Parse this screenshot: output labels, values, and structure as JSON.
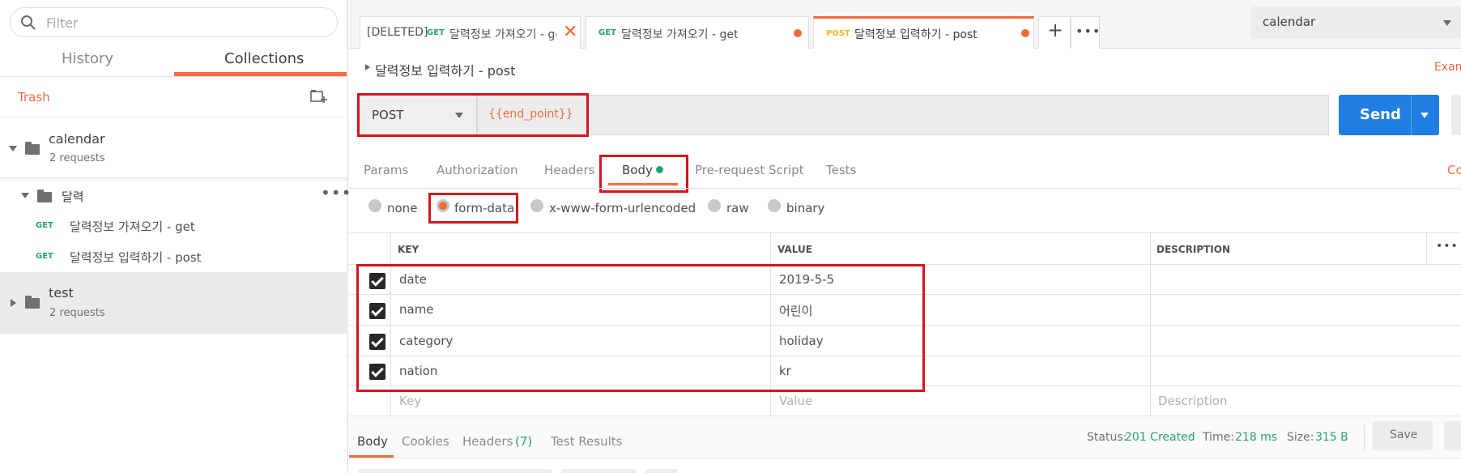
{
  "sidebar": {
    "filter_placeholder": "Filter",
    "tabs": [
      "History",
      "Collections"
    ],
    "trash_label": "Trash",
    "collections": [
      {
        "name": "calendar",
        "count": "2 requests"
      },
      {
        "name": "test",
        "count": "2 requests"
      }
    ],
    "folder": {
      "name": "달력"
    },
    "requests": [
      {
        "method": "GET",
        "name": "달력정보 가져오기 - get"
      },
      {
        "method": "GET",
        "name": "달력정보 입력하기 - post"
      }
    ]
  },
  "tabs": [
    {
      "prefix": "[DELETED]",
      "method": "GET",
      "name": "달력정보 가져오기 - get"
    },
    {
      "method": "GET",
      "name": "달력정보 가져오기 - get"
    },
    {
      "method": "POST",
      "name": "달력정보 입력하기 - post"
    }
  ],
  "environment": "calendar",
  "request": {
    "title": "달력정보 입력하기 - post",
    "examples_label": "Exam",
    "method": "POST",
    "url": "{{end_point}}",
    "send_label": "Send"
  },
  "request_tabs": [
    "Params",
    "Authorization",
    "Headers",
    "Body",
    "Pre-request Script",
    "Tests"
  ],
  "right_link": "Co",
  "body_types": [
    "none",
    "form-data",
    "x-www-form-urlencoded",
    "raw",
    "binary"
  ],
  "table": {
    "headers": [
      "KEY",
      "VALUE",
      "DESCRIPTION"
    ],
    "rows": [
      {
        "key": "date",
        "value": "2019-5-5"
      },
      {
        "key": "name",
        "value": "어린이"
      },
      {
        "key": "category",
        "value": "holiday"
      },
      {
        "key": "nation",
        "value": "kr"
      }
    ],
    "placeholders": {
      "key": "Key",
      "value": "Value",
      "description": "Description"
    }
  },
  "response": {
    "tabs": [
      "Body",
      "Cookies",
      "Headers",
      "Test Results"
    ],
    "headers_count": "(7)",
    "status_label": "Status:",
    "status_value": "201 Created",
    "time_label": "Time:",
    "time_value": "218 ms",
    "size_label": "Size:",
    "size_value": "315 B",
    "save_label": "Save"
  },
  "colors": {
    "accent": "#f26b3a",
    "send": "#1f7fe3",
    "get": "#26a36a",
    "post": "#f2b81f",
    "highlight": "#d1161d"
  }
}
